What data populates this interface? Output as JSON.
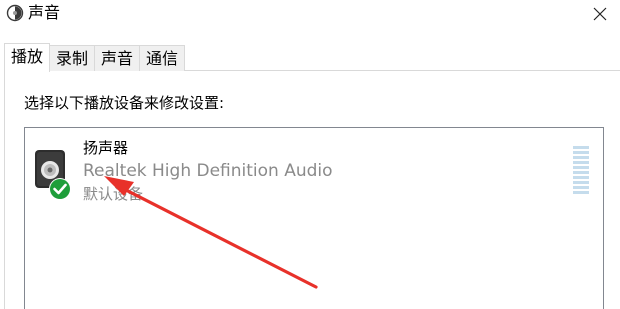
{
  "window": {
    "title": "声音",
    "icon": "speaker-icon"
  },
  "tabs": [
    {
      "label": "播放",
      "active": true
    },
    {
      "label": "录制",
      "active": false
    },
    {
      "label": "声音",
      "active": false
    },
    {
      "label": "通信",
      "active": false
    }
  ],
  "playback": {
    "instruction": "选择以下播放设备来修改设置:",
    "devices": [
      {
        "name": "扬声器",
        "driver": "Realtek High Definition Audio",
        "status": "默认设备",
        "icon": "speaker-device-icon",
        "badge": "default-check-icon",
        "level_fraction": 0
      }
    ]
  },
  "colors": {
    "check_green": "#1e9e3a",
    "annotation_red": "#e8312a",
    "meter_bar": "#c5dcec"
  }
}
